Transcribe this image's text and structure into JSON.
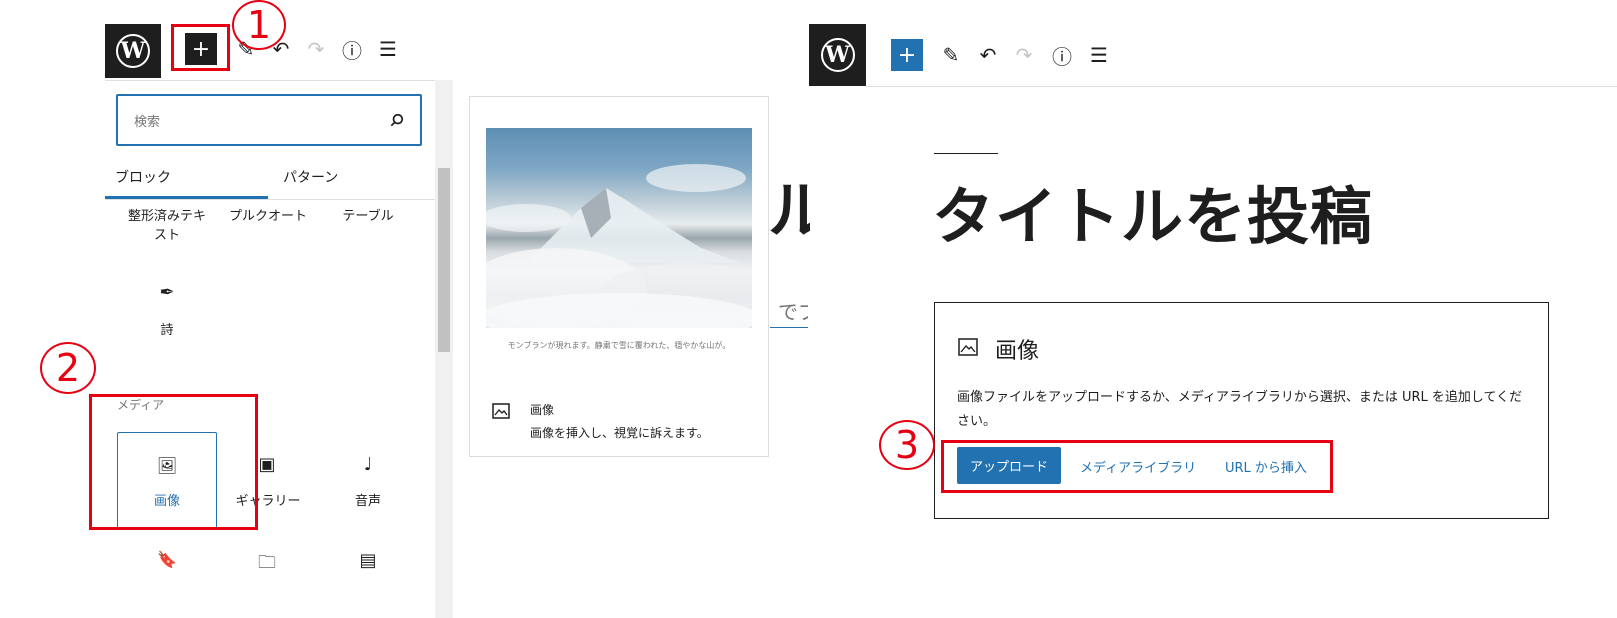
{
  "toolbar": {
    "logo_glyph": "W",
    "add_label": "+",
    "icons": [
      "plus-icon",
      "pen-icon",
      "undo-icon",
      "redo-icon",
      "info-icon",
      "list-view-icon"
    ],
    "pen_glyph": "✎",
    "undo_glyph": "↶",
    "redo_glyph": "↷",
    "info_glyph": "ⓘ",
    "list_glyph": "☰"
  },
  "inserter": {
    "search_placeholder": "検索",
    "tabs": [
      {
        "label": "ブロック"
      },
      {
        "label": "パターン"
      }
    ],
    "text_blocks": [
      {
        "label": "整形済みテキスト"
      },
      {
        "label": "プルクオート"
      },
      {
        "label": "テーブル"
      }
    ],
    "poem": {
      "label": "詩",
      "icon": "✒"
    },
    "media_heading": "メディア",
    "media_blocks": [
      {
        "label": "画像",
        "icon": "🖼"
      },
      {
        "label": "ギャラリー",
        "icon": "▣"
      },
      {
        "label": "音声",
        "icon": "♩"
      }
    ],
    "bottom_icons": [
      "🔖",
      "🗀",
      "▤"
    ]
  },
  "preview": {
    "caption": "モンブランが現れます。静粛で雪に覆われた、穏やかな山が。",
    "block_name": "画像",
    "block_description": "画像を挿入し、視覚に訴えます。",
    "behind_title_fragment": "ル",
    "behind_text_fragment": "でブ"
  },
  "editor": {
    "post_title": "タイトルを投稿",
    "image_block": {
      "title": "画像",
      "instructions": "画像ファイルをアップロードするか、メディアライブラリから選択、または URL を追加してください。",
      "upload_label": "アップロード",
      "media_library_label": "メディアライブラリ",
      "url_insert_label": "URL から挿入"
    }
  },
  "annotations": {
    "step1": "1",
    "step2": "2",
    "step3": "3"
  },
  "colors": {
    "accent": "#2271b1",
    "dark": "#1e1e1e",
    "annotation_red": "#e60012"
  }
}
